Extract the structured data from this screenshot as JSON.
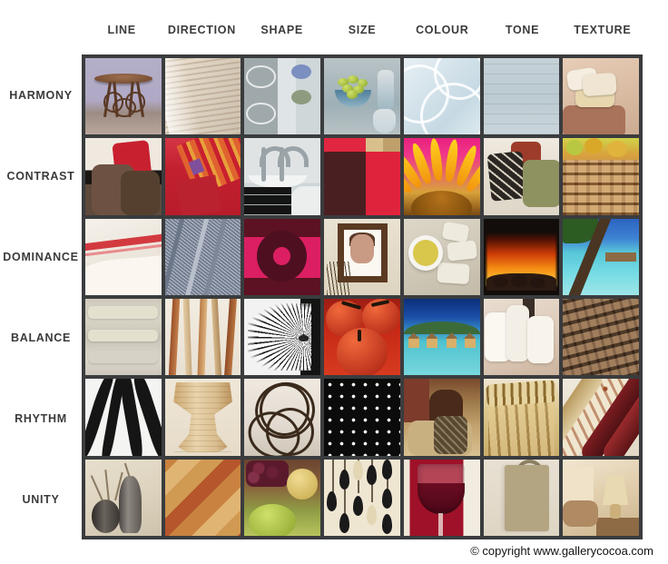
{
  "poster": {
    "copyright": "© copyright www.gallerycocoa.com",
    "grid_border_color": "#3a3c3e",
    "background_color": "#ffffff",
    "label_color": "#3b3b3b"
  },
  "columns": [
    {
      "label": "LINE"
    },
    {
      "label": "DIRECTION"
    },
    {
      "label": "SHAPE"
    },
    {
      "label": "SIZE"
    },
    {
      "label": "COLOUR"
    },
    {
      "label": "TONE"
    },
    {
      "label": "TEXTURE"
    }
  ],
  "rows": [
    {
      "label": "HARMONY"
    },
    {
      "label": "CONTRAST"
    },
    {
      "label": "DOMINANCE"
    },
    {
      "label": "BALANCE"
    },
    {
      "label": "RHYTHM"
    },
    {
      "label": "UNITY"
    }
  ],
  "cells": [
    {
      "row": "HARMONY",
      "column": "LINE",
      "caption": "ornate wrought-iron table on lavender background"
    },
    {
      "row": "HARMONY",
      "column": "DIRECTION",
      "caption": "cream venetian blinds with diagonal light"
    },
    {
      "row": "HARMONY",
      "column": "SHAPE",
      "caption": "grey panel with circles and dots motif"
    },
    {
      "row": "HARMONY",
      "column": "SIZE",
      "caption": "bowl of green grapes with glassware"
    },
    {
      "row": "HARMONY",
      "column": "COLOUR",
      "caption": "pale blue swirled glass"
    },
    {
      "row": "HARMONY",
      "column": "TONE",
      "caption": "pale blue-grey horizontal tonal bands"
    },
    {
      "row": "HARMONY",
      "column": "TEXTURE",
      "caption": "cream cushions on brown sofa"
    },
    {
      "row": "CONTRAST",
      "column": "LINE",
      "caption": "red and brown cushions against dark band"
    },
    {
      "row": "CONTRAST",
      "column": "DIRECTION",
      "caption": "red and orange striped folded fabric"
    },
    {
      "row": "CONTRAST",
      "column": "SHAPE",
      "caption": "chrome taps, white basin, black mosaic tile"
    },
    {
      "row": "CONTRAST",
      "column": "SIZE",
      "caption": "red, maroon and tan colour blocks"
    },
    {
      "row": "CONTRAST",
      "column": "COLOUR",
      "caption": "yellow sunflower on hot pink"
    },
    {
      "row": "CONTRAST",
      "column": "TONE",
      "caption": "dark patterned cushion beside olive cushion"
    },
    {
      "row": "CONTRAST",
      "column": "TEXTURE",
      "caption": "woven wicker basket with fruit"
    },
    {
      "row": "DOMINANCE",
      "column": "LINE",
      "caption": "white linen with bold red stripe"
    },
    {
      "row": "DOMINANCE",
      "column": "DIRECTION",
      "caption": "grey diagonal pinstripe denim with seams"
    },
    {
      "row": "DOMINANCE",
      "column": "SHAPE",
      "caption": "large pink circle on maroon ground"
    },
    {
      "row": "DOMINANCE",
      "column": "SIZE",
      "caption": "framed portrait above vase of twigs"
    },
    {
      "row": "DOMINANCE",
      "column": "COLOUR",
      "caption": "bowl of olive oil with white stones"
    },
    {
      "row": "DOMINANCE",
      "column": "TONE",
      "caption": "fireplace flames glowing in dark hearth"
    },
    {
      "row": "DOMINANCE",
      "column": "TEXTURE",
      "caption": "palm trunk over tropical lagoon"
    },
    {
      "row": "BALANCE",
      "column": "LINE",
      "caption": "cream padded headboard panels"
    },
    {
      "row": "BALANCE",
      "column": "DIRECTION",
      "caption": "vertical wooden dowels in varied tones"
    },
    {
      "row": "BALANCE",
      "column": "SHAPE",
      "caption": "black and white feather fan"
    },
    {
      "row": "BALANCE",
      "column": "SIZE",
      "caption": "glossy red tomatoes close-up"
    },
    {
      "row": "BALANCE",
      "column": "COLOUR",
      "caption": "over-water bungalows on turquoise lagoon"
    },
    {
      "row": "BALANCE",
      "column": "TONE",
      "caption": "stacked white towels and cushions"
    },
    {
      "row": "BALANCE",
      "column": "TEXTURE",
      "caption": "dark brown woven rattan"
    },
    {
      "row": "RHYTHM",
      "column": "LINE",
      "caption": "black and white zebra stripes"
    },
    {
      "row": "RHYTHM",
      "column": "DIRECTION",
      "caption": "turned pale wooden vessel"
    },
    {
      "row": "RHYTHM",
      "column": "SHAPE",
      "caption": "open wicker sphere sculpture"
    },
    {
      "row": "RHYTHM",
      "column": "SIZE",
      "caption": "white polka dots on black"
    },
    {
      "row": "RHYTHM",
      "column": "COLOUR",
      "caption": "warm bedroom with carved headboard"
    },
    {
      "row": "RHYTHM",
      "column": "TONE",
      "caption": "gold pleated fabric stool"
    },
    {
      "row": "RHYTHM",
      "column": "TEXTURE",
      "caption": "rolls of patterned and plain fabric"
    },
    {
      "row": "UNITY",
      "column": "LINE",
      "caption": "dark ceramic vases with bare twigs"
    },
    {
      "row": "UNITY",
      "column": "DIRECTION",
      "caption": "diagonal wood-grain bands"
    },
    {
      "row": "UNITY",
      "column": "SHAPE",
      "caption": "still life of grapes, pear and melon"
    },
    {
      "row": "UNITY",
      "column": "SIZE",
      "caption": "black teardrop pattern on cream"
    },
    {
      "row": "UNITY",
      "column": "COLOUR",
      "caption": "glass of red wine on red ground"
    },
    {
      "row": "UNITY",
      "column": "TONE",
      "caption": "neutral linen bag on pale wall"
    },
    {
      "row": "UNITY",
      "column": "TEXTURE",
      "caption": "bedside lamp and pillows in warm neutrals"
    }
  ]
}
